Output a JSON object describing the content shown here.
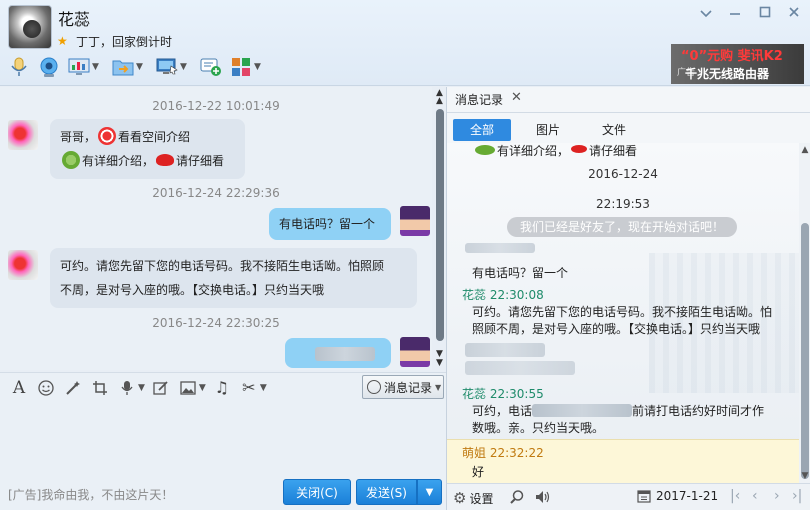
{
  "window": {
    "contact_name": "花蕊",
    "signature": "丁丁，回家倒计时",
    "controls": [
      "chevron-down-icon",
      "minimize-icon",
      "maximize-icon",
      "close-icon"
    ]
  },
  "toolbar": {
    "buttons": [
      {
        "name": "voice-call-icon",
        "dropdown": false,
        "color": "#3a8fd8"
      },
      {
        "name": "video-call-icon",
        "dropdown": false,
        "color": "#2b86d6"
      },
      {
        "name": "remote-assist-icon",
        "dropdown": true,
        "color": "#3b7fc4"
      },
      {
        "name": "send-file-icon",
        "dropdown": true,
        "color": "#f0a020"
      },
      {
        "name": "screen-share-icon",
        "dropdown": true,
        "color": "#2f7bd0"
      },
      {
        "name": "create-group-icon",
        "dropdown": false,
        "color": "#2aa44e"
      },
      {
        "name": "apps-icon",
        "dropdown": true,
        "color": "#e0802a"
      }
    ]
  },
  "ad_banner": {
    "line1": "“0”元购 斐讯K2",
    "line2": "千兆无线路由器",
    "tag": "广告"
  },
  "chat": {
    "messages": [
      {
        "type": "time",
        "text": "2016-12-22 10:01:49"
      },
      {
        "type": "in",
        "line1_a": "哥哥，",
        "line1_b": "看看空间介绍",
        "line2_a": "有详细介绍，",
        "line2_b": "请仔细看"
      },
      {
        "type": "time",
        "text": "2016-12-24 22:29:36"
      },
      {
        "type": "out",
        "text": "有电话吗？留一个"
      },
      {
        "type": "in",
        "line1": "可约。请您先留下您的电话号码。我不接陌生电话呦。怕照顾",
        "line2": "不周，是对号入座的哦。【交换电话。】只约当天哦"
      },
      {
        "type": "time",
        "text": "2016-12-24 22:30:25"
      },
      {
        "type": "out_blurred"
      }
    ]
  },
  "input_toolbar": {
    "icons": [
      "font-icon",
      "emoji-icon",
      "magic-icon",
      "screenshot-icon",
      "voice-message-icon",
      "edit-icon",
      "image-icon",
      "music-icon",
      "scissors-icon"
    ],
    "history_label": "消息记录"
  },
  "bottom": {
    "ad_text": "[广告]我命由我，不由这片天！",
    "close_label": "关闭(C)",
    "send_label": "发送(S)"
  },
  "history": {
    "tab_label": "消息记录",
    "filters": [
      "全部",
      "图片",
      "文件"
    ],
    "partial_line_a": "有详细介绍，",
    "partial_line_b": "请仔细看",
    "date": "2016-12-24",
    "time1": "22:19:53",
    "system_msg": "我们已经是好友了，现在开始对话吧！",
    "msg1": "有电话吗？留一个",
    "sender1": "花蕊  22:30:08",
    "msg2_l1": "可约。请您先留下您的电话号码。我不接陌生电话呦。怕",
    "msg2_l2": "照顾不周，是对号入座的哦。【交换电话。】只约当天哦",
    "sender2": "花蕊  22:30:55",
    "msg3_l1a": "可约，电话",
    "msg3_l1b": "前请打电话约好时间才作",
    "msg3_l2": "数哦。亲。只约当天哦。",
    "sender3": "萌姐  22:32:22",
    "msg4": "好"
  },
  "history_bottom": {
    "settings_label": "设置",
    "date": "2017-1-21"
  }
}
